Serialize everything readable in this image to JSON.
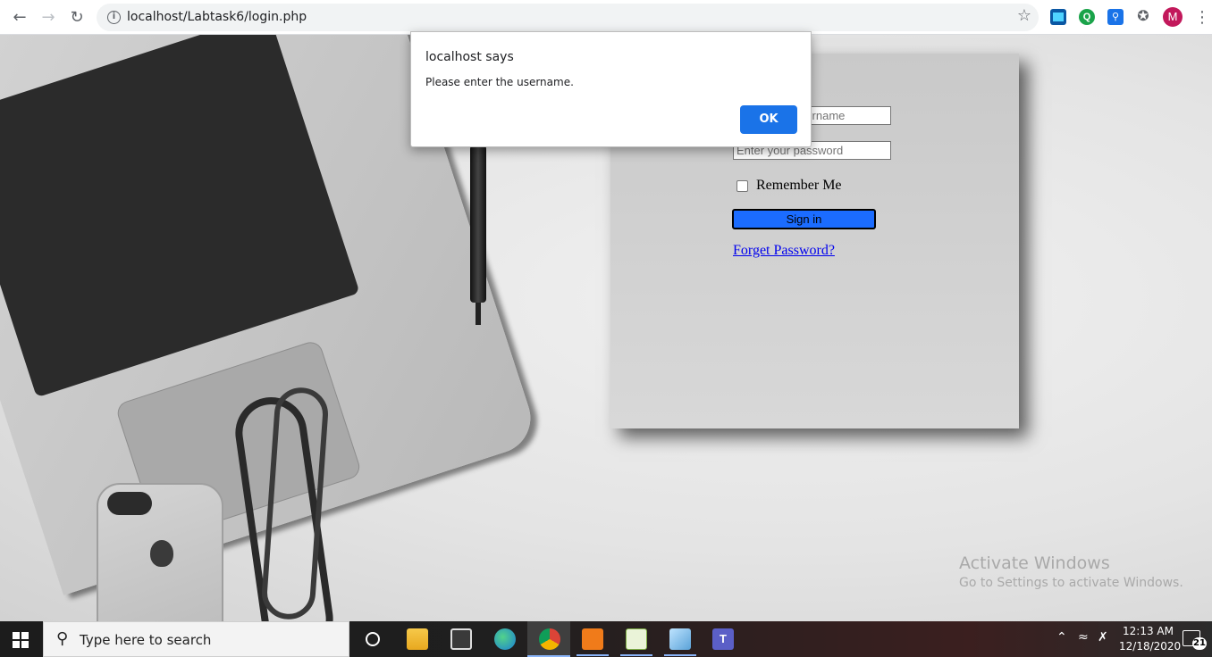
{
  "browser": {
    "url": "localhost/Labtask6/login.php",
    "back_icon": "arrow-left-icon",
    "forward_icon": "arrow-right-icon",
    "reload_icon": "reload-icon",
    "profile_initial": "M"
  },
  "login": {
    "username_placeholder": "Enter your username",
    "password_placeholder": "Enter your password",
    "remember_label": "Remember Me",
    "remember_checked": false,
    "signin_label": "Sign in",
    "forget_link": "Forget Password?",
    "signin_color": "#1b6cff"
  },
  "dialog": {
    "title": "localhost says",
    "message": "Please enter the username.",
    "ok_label": "OK",
    "ok_color": "#1a73e8"
  },
  "watermark": {
    "title": "Activate Windows",
    "subtitle": "Go to Settings to activate Windows."
  },
  "taskbar": {
    "search_placeholder": "Type here to search",
    "apps": [
      "file-explorer",
      "microsoft-store",
      "edge",
      "chrome",
      "xampp",
      "notepad-plus",
      "pencil-app",
      "teams"
    ],
    "time": "12:13 AM",
    "date": "12/18/2020",
    "notification_count": "21"
  }
}
